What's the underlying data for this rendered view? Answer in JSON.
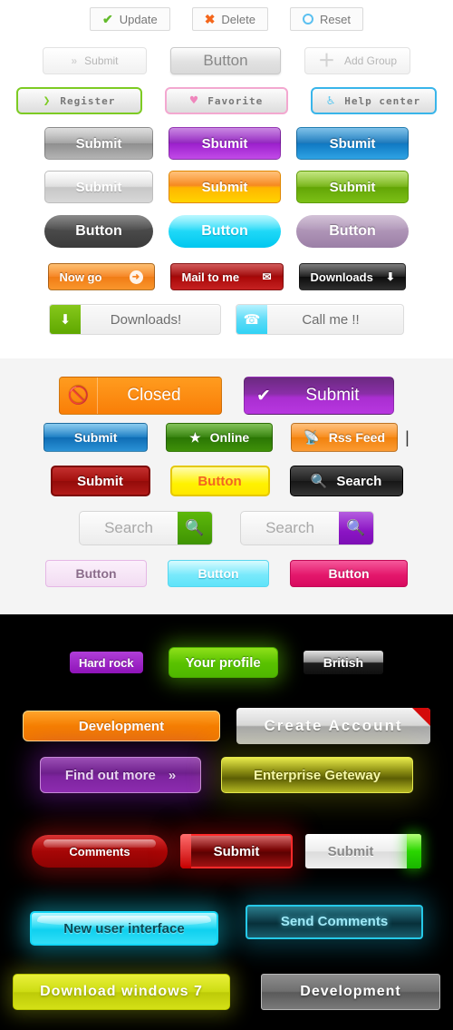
{
  "page": {
    "title": "Web Button Set Showcase",
    "sections": [
      "light",
      "gray",
      "dark"
    ],
    "background_light": "#ffffff",
    "background_gray": "#f4f4f4",
    "background_dark": "#000000"
  },
  "light_section": {
    "row1": [
      {
        "label": "Update",
        "icon": "check-icon",
        "glyph": "✔",
        "color": "#63bb2b"
      },
      {
        "label": "Delete",
        "icon": "cross-icon",
        "glyph": "✖",
        "color": "#f4661b"
      },
      {
        "label": "Reset",
        "icon": "circle-icon",
        "glyph": "",
        "color": "#5bc0f0"
      }
    ],
    "row2": [
      {
        "label": "Submit",
        "icon": "double-chevron-icon",
        "glyph": "»"
      },
      {
        "label": "Button",
        "icon": "",
        "glyph": ""
      },
      {
        "label": "Add Group",
        "icon": "plus-icon",
        "glyph": "＋"
      }
    ],
    "row3": [
      {
        "label": "Register",
        "icon": "chevron-right-icon",
        "glyph": "❯",
        "border": "#7dcb23"
      },
      {
        "label": "Favorite",
        "icon": "heart-icon",
        "glyph": "♥",
        "border": "#f3a8d0"
      },
      {
        "label": "Help center",
        "icon": "question-icon",
        "glyph": "⍰",
        "border": "#39b5ea"
      }
    ],
    "row4": [
      {
        "label": "Submit",
        "style": "gray"
      },
      {
        "label": "Sbumit",
        "style": "purple"
      },
      {
        "label": "Sbumit",
        "style": "blue"
      }
    ],
    "row5": [
      {
        "label": "Submit",
        "style": "silver"
      },
      {
        "label": "Submit",
        "style": "orange"
      },
      {
        "label": "Submit",
        "style": "green"
      }
    ],
    "row6": [
      {
        "label": "Button",
        "style": "dark"
      },
      {
        "label": "Button",
        "style": "cyan"
      },
      {
        "label": "Button",
        "style": "mauve"
      }
    ],
    "row7": [
      {
        "label": "Now go",
        "icon": "circle-arrow-icon",
        "glyph": "➜",
        "style": "orange"
      },
      {
        "label": "Mail to me",
        "icon": "envelope-icon",
        "glyph": "✉",
        "style": "red"
      },
      {
        "label": "Downloads",
        "icon": "down-arrow-icon",
        "glyph": "⬇",
        "style": "black"
      }
    ],
    "row8": [
      {
        "label": "Downloads!",
        "icon": "download-arrow-icon",
        "glyph": "⬇",
        "style": "green"
      },
      {
        "label": "Call me !!",
        "icon": "telephone-icon",
        "glyph": "☎",
        "style": "cyan"
      }
    ]
  },
  "gray_section": {
    "row1": [
      {
        "label": "Closed",
        "icon": "no-entry-icon",
        "glyph": "⃠",
        "style": "orange"
      },
      {
        "label": "Submit",
        "icon": "check-icon",
        "glyph": "✔",
        "style": "purple"
      }
    ],
    "row2": [
      {
        "label": "Submit",
        "icon": "",
        "glyph": "",
        "style": "blue"
      },
      {
        "label": "Online",
        "icon": "star-icon",
        "glyph": "★",
        "style": "green"
      },
      {
        "label": "Rss Feed",
        "icon": "rss-icon",
        "glyph": "⧖",
        "style": "orange"
      }
    ],
    "caret_mark": "|",
    "row3": [
      {
        "label": "Submit",
        "icon": "",
        "glyph": "",
        "style": "red"
      },
      {
        "label": "Button",
        "icon": "",
        "glyph": "",
        "style": "yellow"
      },
      {
        "label": "Search",
        "icon": "magnifier-icon",
        "glyph": "⚲",
        "style": "black"
      }
    ],
    "searchboxes": [
      {
        "placeholder": "Search",
        "value": "Search",
        "button_icon": "magnifier-icon",
        "glyph": "⚲",
        "accent": "#4da60a"
      },
      {
        "placeholder": "Search",
        "value": "Search",
        "button_icon": "magnifier-icon",
        "glyph": "⚲",
        "accent": "#8b14c4"
      }
    ],
    "row5": [
      {
        "label": "Button",
        "style": "pale-pink"
      },
      {
        "label": "Button",
        "style": "cyan"
      },
      {
        "label": "Button",
        "style": "magenta"
      }
    ]
  },
  "dark_section": {
    "row1": [
      {
        "label": "Hard rock",
        "style": "purple"
      },
      {
        "label": "Your profile",
        "style": "green-glow"
      },
      {
        "label": "British",
        "style": "silver-black"
      }
    ],
    "row2": [
      {
        "label": "Development",
        "style": "orange"
      },
      {
        "label": "Create Account",
        "style": "silver-ribbon",
        "ribbon_color": "#d40a0a"
      }
    ],
    "row3": [
      {
        "label": "Find out more",
        "icon": "double-chevron-icon",
        "glyph": "»",
        "style": "purple-glow"
      },
      {
        "label": "Enterprise Geteway",
        "style": "yellow-glow"
      }
    ],
    "row4": [
      {
        "label": "Comments",
        "style": "red-glow"
      },
      {
        "label": "Submit",
        "style": "red-bar"
      },
      {
        "label": "Submit",
        "style": "white-green-bar"
      }
    ],
    "row5": [
      {
        "label": "New user interface",
        "style": "cyan-glow"
      },
      {
        "label": "Send Comments",
        "style": "teal-outline"
      }
    ],
    "row6": [
      {
        "label": "Download windows 7",
        "style": "lime"
      },
      {
        "label": "Development",
        "style": "gray"
      }
    ]
  }
}
